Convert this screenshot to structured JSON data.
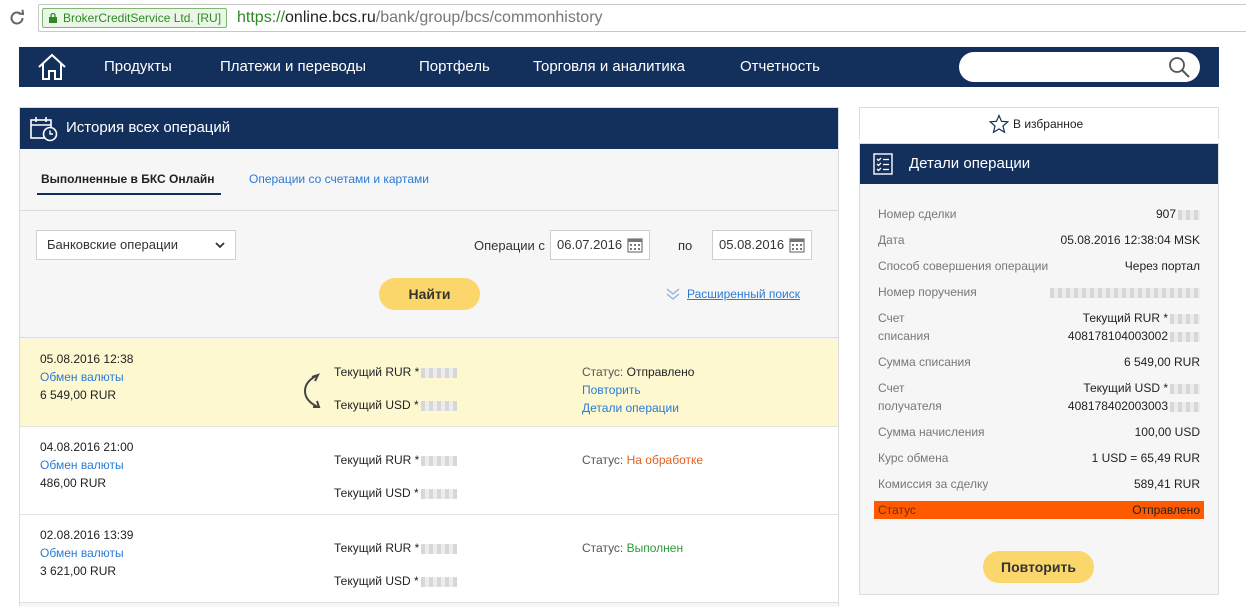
{
  "browser": {
    "ev_label": "BrokerCreditService Ltd. [RU]",
    "url_proto": "https://",
    "url_host": "online.bcs.ru",
    "url_path": "/bank/group/bcs/commonhistory"
  },
  "nav": {
    "items": [
      {
        "label": "Продукты"
      },
      {
        "label": "Платежи и переводы"
      },
      {
        "label": "Портфель"
      },
      {
        "label": "Торговля и аналитика"
      },
      {
        "label": "Отчетность"
      }
    ],
    "search_value": ""
  },
  "history": {
    "title": "История всех операций",
    "tabs": [
      {
        "label": "Выполненные в БКС Онлайн",
        "active": true
      },
      {
        "label": "Операции со счетами и картами",
        "active": false
      }
    ],
    "filters": {
      "category": "Банковские операции",
      "from_label": "Операции с",
      "from_date": "06.07.2016",
      "to_label": "по",
      "to_date": "05.08.2016",
      "find_label": "Найти",
      "advanced_label": "Расширенный поиск"
    },
    "operations": [
      {
        "datetime": "05.08.2016 12:38",
        "type": "Обмен валюты",
        "amount": "6 549,00 RUR",
        "from": "Текущий RUR *",
        "to": "Текущий USD *",
        "status_label": "Статус:",
        "status": "Отправлено",
        "repeat_label": "Повторить",
        "details_label": "Детали операции"
      },
      {
        "datetime": "04.08.2016 21:00",
        "type": "Обмен валюты",
        "amount": "486,00 RUR",
        "from": "Текущий RUR *",
        "to": "Текущий USD *",
        "status_label": "Статус:",
        "status": "На обработке"
      },
      {
        "datetime": "02.08.2016 13:39",
        "type": "Обмен валюты",
        "amount": "3 621,00 RUR",
        "from": "Текущий RUR *",
        "to": "Текущий USD *",
        "status_label": "Статус:",
        "status": "Выполнен"
      }
    ]
  },
  "details": {
    "favorite_label": "В избранное",
    "title": "Детали операции",
    "rows": [
      {
        "label": "Номер сделки",
        "value": "907"
      },
      {
        "label": "Дата",
        "value": "05.08.2016 12:38:04 MSK"
      },
      {
        "label": "Способ совершения операции",
        "value": "Через портал"
      },
      {
        "label": "Номер поручения",
        "value": ""
      },
      {
        "label": "Счет",
        "label2": "списания",
        "value": "Текущий RUR *",
        "value2": "408178104003002"
      },
      {
        "label": "Сумма списания",
        "value": "6 549,00 RUR"
      },
      {
        "label": "Счет",
        "label2": "получателя",
        "value": "Текущий USD *",
        "value2": "408178402003003"
      },
      {
        "label": "Сумма начисления",
        "value": "100,00 USD"
      },
      {
        "label": "Курс обмена",
        "value": "1 USD = 65,49 RUR"
      },
      {
        "label": "Комиссия за сделку",
        "value": "589,41 RUR"
      }
    ],
    "status_label": "Статус",
    "status_value": "Отправлено",
    "repeat_label": "Повторить"
  },
  "colors": {
    "nav_bg": "#13305d",
    "accent_button": "#fbd66a",
    "link": "#2a7bd6",
    "highlight_row": "#fdf8cf",
    "status_bar": "#ff5a00",
    "status_processing": "#e0601f",
    "status_done": "#2b9b3a"
  }
}
